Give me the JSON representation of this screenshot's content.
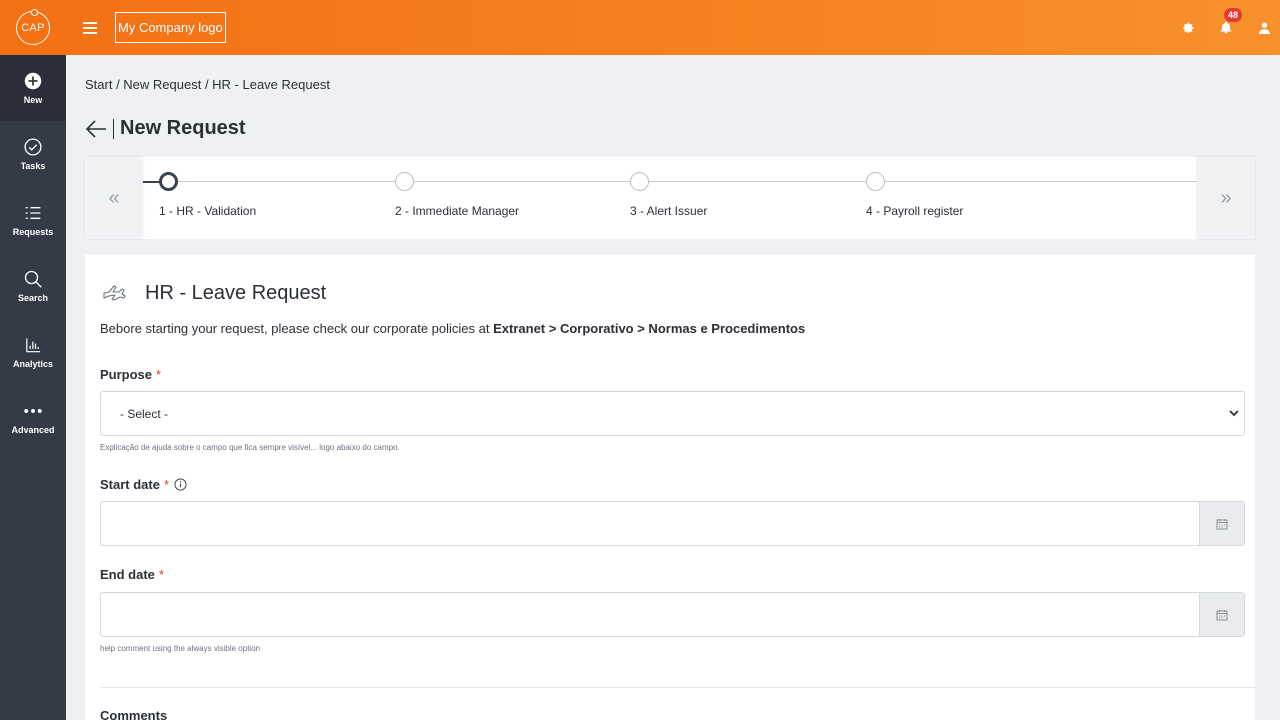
{
  "header": {
    "brand_text": "CAP",
    "company_logo_text": "My Company logo",
    "notification_count": "48"
  },
  "sidebar": {
    "items": [
      {
        "label": "New",
        "icon": "plus-circle-icon"
      },
      {
        "label": "Tasks",
        "icon": "check-circle-icon"
      },
      {
        "label": "Requests",
        "icon": "list-icon"
      },
      {
        "label": "Search",
        "icon": "search-icon"
      },
      {
        "label": "Analytics",
        "icon": "chart-icon"
      },
      {
        "label": "Advanced",
        "icon": "more-dots-icon"
      }
    ]
  },
  "breadcrumb": "Start / New Request / HR - Leave Request",
  "page_title": "New Request",
  "stepper": {
    "prev": "«",
    "next": "»",
    "steps": [
      {
        "label": "1 - HR - Validation"
      },
      {
        "label": "2 - Immediate Manager"
      },
      {
        "label": "3 - Alert Issuer"
      },
      {
        "label": "4 - Payroll register"
      }
    ]
  },
  "form": {
    "title": "HR - Leave Request",
    "policy_prefix": "Bebore starting your request, please check our corporate policies at ",
    "policy_path": "Extranet > Corporativo > Normas e Procedimentos",
    "purpose": {
      "label": "Purpose",
      "required_mark": "*",
      "selected": "- Select -",
      "help": "Explicação de ajuda sobre o campo que fica sempre visível... logo abaixo do campo."
    },
    "start_date": {
      "label": "Start date",
      "required_mark": "*",
      "value": ""
    },
    "end_date": {
      "label": "End date",
      "required_mark": "*",
      "value": "",
      "help": "help comment using the always visible option"
    },
    "comments": {
      "label": "Comments"
    }
  }
}
